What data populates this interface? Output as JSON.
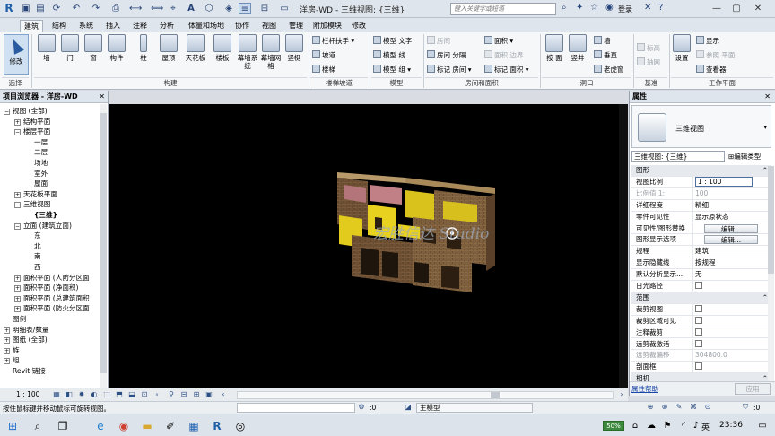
{
  "app": {
    "title": "洋房-WD - 三维视图: {三维}",
    "search_placeholder": "键入关键字或短语",
    "login_label": "登录"
  },
  "qat": {
    "icons": [
      "revit-logo-icon",
      "open-icon",
      "save-icon",
      "sync-icon",
      "undo-icon",
      "redo-icon",
      "print-icon",
      "measure-icon",
      "dimension-icon",
      "tag-icon",
      "text-icon",
      "3d-view-icon",
      "section-icon",
      "thin-lines-icon",
      "close-hidden-icon",
      "switch-windows-icon"
    ]
  },
  "tabs": [
    "建筑",
    "结构",
    "系统",
    "插入",
    "注释",
    "分析",
    "体量和场地",
    "协作",
    "视图",
    "管理",
    "附加模块",
    "修改"
  ],
  "ribbon": {
    "select_panel": {
      "modify_label": "修改",
      "label": "选择"
    },
    "build_panel": {
      "label": "构建",
      "tools": [
        "墙",
        "门",
        "窗",
        "构件",
        "柱",
        "屋顶",
        "天花板",
        "楼板",
        "幕墙系统",
        "幕墙网格",
        "竖梃"
      ]
    },
    "circulation_panel": {
      "label": "楼梯坡道",
      "tools": [
        "栏杆扶手",
        "坡道",
        "楼梯"
      ]
    },
    "model_panel": {
      "label": "模型",
      "tools": [
        "模型 文字",
        "模型 线",
        "模型 组"
      ]
    },
    "room_panel": {
      "label": "房间和面积",
      "tools": [
        "房间",
        "房间 分隔",
        "标记 房间",
        "面积",
        "面积 边界",
        "标记 面积"
      ]
    },
    "opening_panel": {
      "label": "洞口",
      "tools": [
        "按 面",
        "竖井",
        "墙",
        "垂直",
        "老虎窗"
      ]
    },
    "datum_panel": {
      "label": "基准",
      "tools": [
        "标高",
        "轴网"
      ]
    },
    "workplane_panel": {
      "label": "工作平面",
      "tools": [
        "设置",
        "显示",
        "参照 平面",
        "查看器"
      ]
    }
  },
  "browser": {
    "title": "项目浏览器 - 洋房-WD",
    "items": [
      {
        "label": "视图 (全部)",
        "level": 0,
        "exp": "−"
      },
      {
        "label": "结构平面",
        "level": 1,
        "exp": "+"
      },
      {
        "label": "楼层平面",
        "level": 1,
        "exp": "−"
      },
      {
        "label": "一层",
        "level": 2,
        "exp": ""
      },
      {
        "label": "二层",
        "level": 2,
        "exp": ""
      },
      {
        "label": "场地",
        "level": 2,
        "exp": ""
      },
      {
        "label": "室外",
        "level": 2,
        "exp": ""
      },
      {
        "label": "屋面",
        "level": 2,
        "exp": ""
      },
      {
        "label": "天花板平面",
        "level": 1,
        "exp": "+"
      },
      {
        "label": "三维视图",
        "level": 1,
        "exp": "−"
      },
      {
        "label": "{三维}",
        "level": 2,
        "exp": "",
        "selected": true
      },
      {
        "label": "立面 (建筑立面)",
        "level": 1,
        "exp": "−"
      },
      {
        "label": "东",
        "level": 2,
        "exp": ""
      },
      {
        "label": "北",
        "level": 2,
        "exp": ""
      },
      {
        "label": "南",
        "level": 2,
        "exp": ""
      },
      {
        "label": "西",
        "level": 2,
        "exp": ""
      },
      {
        "label": "面积平面 (人防分区面",
        "level": 1,
        "exp": "+"
      },
      {
        "label": "面积平面 (净面积)",
        "level": 1,
        "exp": "+"
      },
      {
        "label": "面积平面 (总建筑面积",
        "level": 1,
        "exp": "+"
      },
      {
        "label": "面积平面 (防火分区面",
        "level": 1,
        "exp": "+"
      },
      {
        "label": "图例",
        "level": 0,
        "exp": ""
      },
      {
        "label": "明细表/数量",
        "level": 0,
        "exp": "+"
      },
      {
        "label": "图纸 (全部)",
        "level": 0,
        "exp": "+"
      },
      {
        "label": "族",
        "level": 0,
        "exp": "+"
      },
      {
        "label": "组",
        "level": 0,
        "exp": "+"
      },
      {
        "label": "Revit 链接",
        "level": 0,
        "exp": ""
      }
    ]
  },
  "viewport": {
    "watermark": "宏胜信达 Studio",
    "background": "#000000"
  },
  "properties": {
    "title": "属性",
    "type_name": "三维视图",
    "instance_selector": "三维视图: {三维}",
    "edit_type_label": "编辑类型",
    "rows": [
      {
        "kind": "group",
        "key": "图形"
      },
      {
        "kind": "input",
        "key": "视图比例",
        "value": "1 : 100"
      },
      {
        "kind": "grey",
        "key": "比例值 1:",
        "value": "100"
      },
      {
        "kind": "text",
        "key": "详细程度",
        "value": "精细"
      },
      {
        "kind": "text",
        "key": "零件可见性",
        "value": "显示原状态"
      },
      {
        "kind": "button",
        "key": "可见性/图形替换",
        "value": "编辑..."
      },
      {
        "kind": "button",
        "key": "图形显示选项",
        "value": "编辑..."
      },
      {
        "kind": "text",
        "key": "规程",
        "value": "建筑"
      },
      {
        "kind": "text",
        "key": "显示隐藏线",
        "value": "按规程"
      },
      {
        "kind": "text",
        "key": "默认分析显示...",
        "value": "无"
      },
      {
        "kind": "check",
        "key": "日光路径",
        "value": ""
      },
      {
        "kind": "group",
        "key": "范围"
      },
      {
        "kind": "check",
        "key": "裁剪视图",
        "value": ""
      },
      {
        "kind": "check",
        "key": "裁剪区域可见",
        "value": ""
      },
      {
        "kind": "check",
        "key": "注释裁剪",
        "value": ""
      },
      {
        "kind": "check",
        "key": "远剪裁激活",
        "value": ""
      },
      {
        "kind": "grey",
        "key": "远剪裁偏移",
        "value": "304800.0"
      },
      {
        "kind": "check",
        "key": "剖面框",
        "value": ""
      },
      {
        "kind": "group",
        "key": "相机"
      }
    ],
    "help_label": "属性帮助",
    "apply_label": "应用"
  },
  "viewbar": {
    "scale": "1 : 100"
  },
  "status": {
    "text": "按住鼠标键并移动鼠标可旋转视图。",
    "zero": ":0",
    "model": "主模型",
    "zero2": ":0"
  },
  "taskbar": {
    "battery": "50%",
    "lang": "英",
    "clock": "23:36",
    "apps": [
      "windows-start-icon",
      "search-icon",
      "task-view-icon",
      "edge-icon",
      "chrome-icon",
      "folder-icon",
      "notepad-icon",
      "explorer-icon",
      "revit-task-icon",
      "media-icon"
    ]
  },
  "colors": {
    "ribbon_bg": "#f5f7f9",
    "accent": "#2a5aa0",
    "yellow_wall": "#e8d21f"
  }
}
